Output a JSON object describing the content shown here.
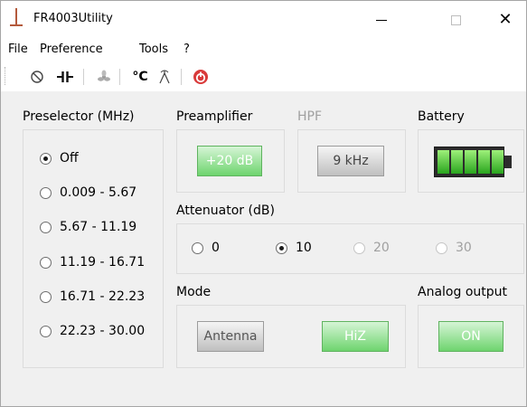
{
  "window": {
    "title": "FR4003Utility",
    "controls": {
      "minimize": "—",
      "maximize": "☐",
      "close": "✕"
    }
  },
  "menu": {
    "items": [
      "File",
      "Preference",
      "Tools",
      "?"
    ]
  },
  "toolbar": {
    "icons": [
      "power-cycle-icon",
      "capacitor-icon",
      "fan-icon",
      "temperature-icon",
      "antenna-icon",
      "shutdown-icon"
    ],
    "temp_glyph": "°C"
  },
  "preselector": {
    "title": "Preselector (MHz)",
    "options": [
      "Off",
      "0.009 - 5.67",
      "5.67 - 11.19",
      "11.19 - 16.71",
      "16.71 - 22.23",
      "22.23 - 30.00"
    ],
    "selected": "Off"
  },
  "preamplifier": {
    "title": "Preamplifier",
    "button": "+20 dB"
  },
  "hpf": {
    "title": "HPF",
    "button": "9 kHz"
  },
  "battery": {
    "title": "Battery",
    "level_fraction": 1.0
  },
  "attenuator": {
    "title": "Attenuator (dB)",
    "options": [
      "0",
      "10",
      "20",
      "30"
    ],
    "selected": "10"
  },
  "mode": {
    "title": "Mode",
    "antenna": "Antenna",
    "hiz": "HiZ"
  },
  "analog_output": {
    "title": "Analog output",
    "button": "ON"
  },
  "colors": {
    "green_button": "#6ed46e",
    "battery_green": "#2aa51e",
    "shutdown_red": "#d93a3a"
  }
}
